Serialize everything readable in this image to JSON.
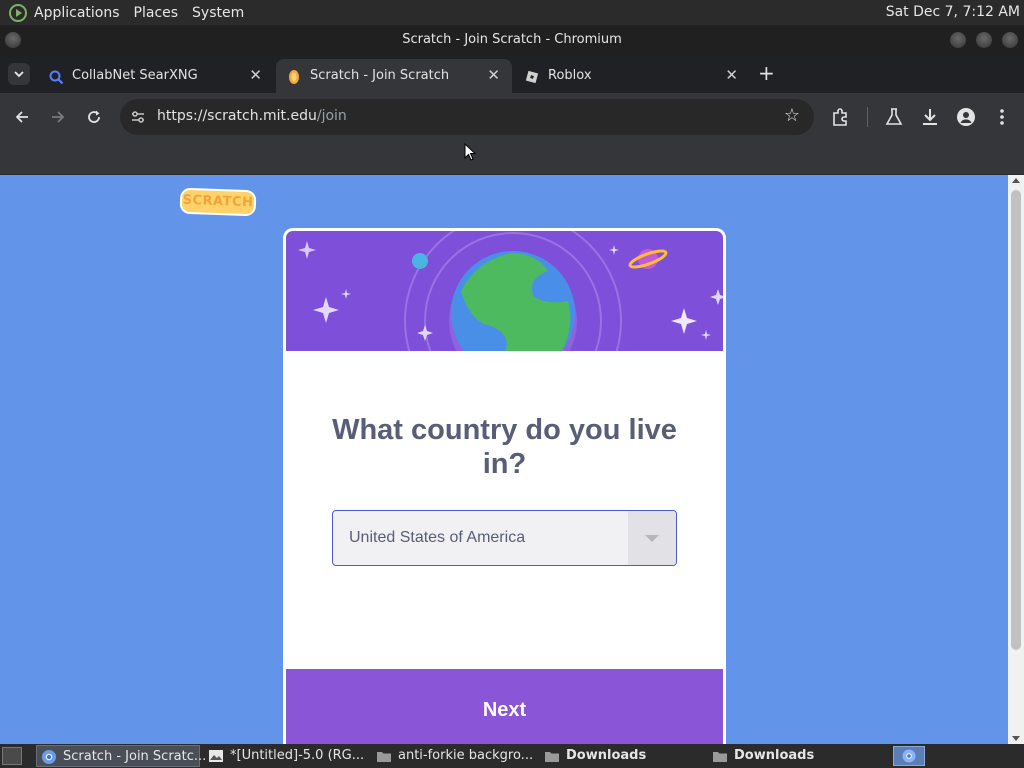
{
  "system_panel": {
    "menus": [
      "Applications",
      "Places",
      "System"
    ],
    "clock": "Sat Dec  7,  7:12 AM"
  },
  "window": {
    "title": "Scratch - Join Scratch - Chromium"
  },
  "tabs": [
    {
      "label": "CollabNet SearXNG",
      "icon": "search-icon",
      "active": false
    },
    {
      "label": "Scratch - Join Scratch",
      "icon": "scratch-cat-icon",
      "active": true
    },
    {
      "label": "Roblox",
      "icon": "roblox-icon",
      "active": false
    }
  ],
  "toolbar": {
    "url_host": "https://scratch.mit.edu",
    "url_path": "/join"
  },
  "page": {
    "logo_text": "SCRATCH",
    "question": "What country do you live in?",
    "country_selected": "United States of America",
    "next_label": "Next"
  },
  "taskbar": {
    "tasks": [
      {
        "label": "Scratch - Join Scratc...",
        "icon": "chromium-icon",
        "active": true
      },
      {
        "label": "*[Untitled]-5.0 (RG...",
        "icon": "image-editor-icon",
        "active": false
      },
      {
        "label": "anti-forkie backgro...",
        "icon": "folder-icon",
        "active": false
      },
      {
        "label": "Downloads",
        "icon": "folder-icon",
        "active": false
      },
      {
        "label": "Downloads",
        "icon": "folder-icon",
        "active": false
      }
    ]
  },
  "colors": {
    "page_background": "#6295ea",
    "card_banner": "#7e4fd8",
    "next_button": "#8a55d7",
    "question_text": "#575e75"
  }
}
